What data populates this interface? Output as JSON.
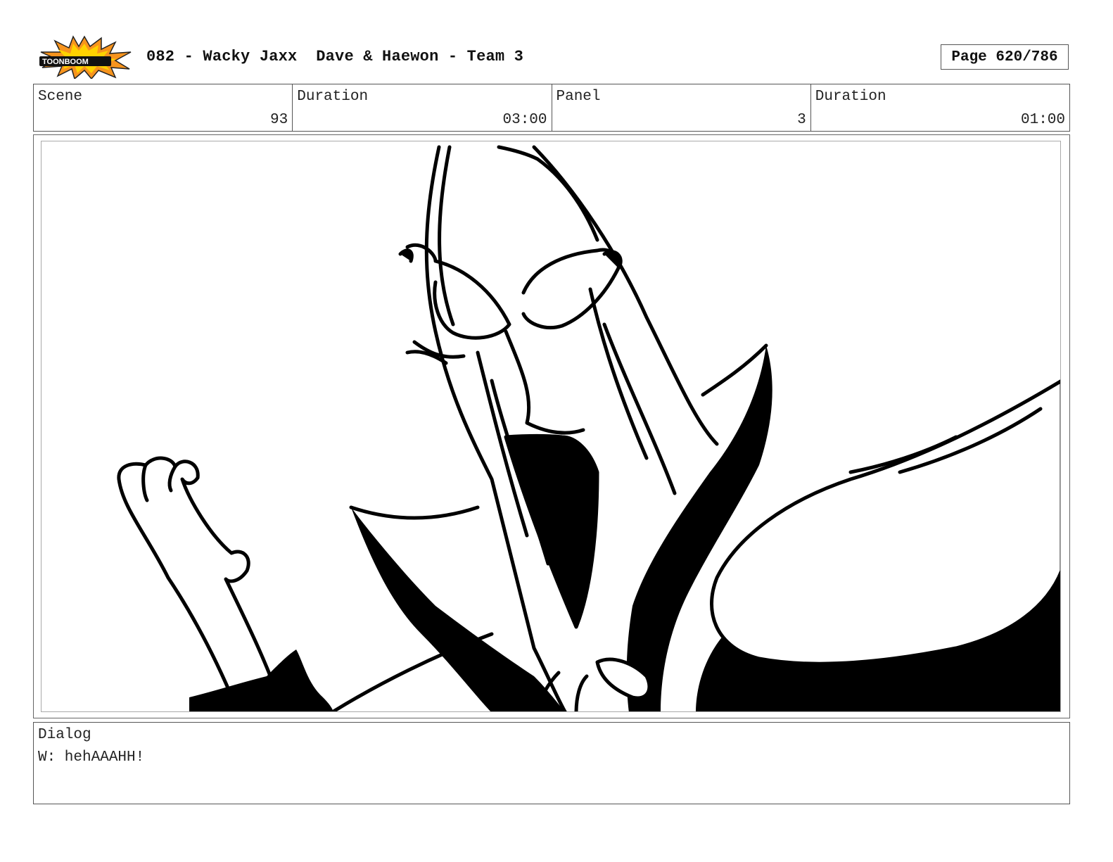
{
  "header": {
    "logo_text": "TOONBOOM",
    "title": "082 - Wacky Jaxx  Dave & Haewon - Team 3",
    "page": "Page 620/786"
  },
  "info": {
    "scene_label": "Scene",
    "scene_value": "93",
    "scene_duration_label": "Duration",
    "scene_duration_value": "03:00",
    "panel_label": "Panel",
    "panel_value": "3",
    "panel_duration_label": "Duration",
    "panel_duration_value": "01:00"
  },
  "dialog": {
    "label": "Dialog",
    "lines": [
      "W: hehAAAHH!"
    ]
  },
  "colors": {
    "ink": "#000000",
    "frame": "#555555",
    "logo_burst": "#f7941d",
    "logo_burst_inner": "#ffd200"
  }
}
